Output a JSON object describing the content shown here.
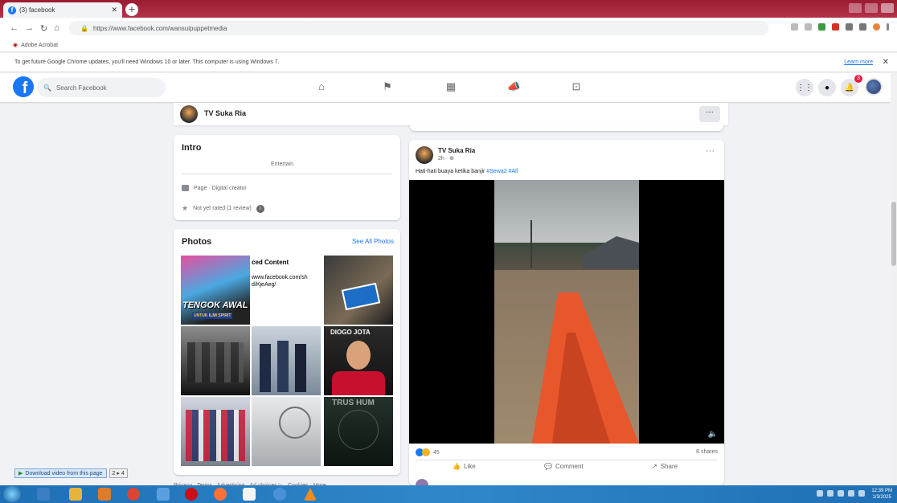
{
  "browser": {
    "tab_title": "(3) facebook",
    "url": "https://www.facebook.com/wansuipuppetmedia",
    "bookmark": "Adobe Acrobat",
    "infobar_text": "To get future Google Chrome updates, you'll need Windows 10 or later. This computer is using Windows 7.",
    "infobar_link": "Learn more"
  },
  "fb": {
    "search_placeholder": "Search Facebook",
    "notification_count": "3"
  },
  "page": {
    "name": "TV Suka Ria",
    "more": "···"
  },
  "intro": {
    "title": "Intro",
    "bio": "Entertain",
    "category": "Page · Digital creator",
    "rating": "Not yet rated (1 review)",
    "rating_info": "i"
  },
  "photos": {
    "title": "Photos",
    "see_all": "See All Photos",
    "tile1_text": "TENGOK AWAL",
    "tile1_sub": "UNTUK ILMI SPIRIT",
    "tile2_title": "ced Content",
    "tile2_link": "www.facebook.com/sh",
    "tile2_link2": "d/KjeAeg/",
    "tile6_text": "DIOGO JOTA",
    "tile9_text": "TRUS HUM"
  },
  "post": {
    "author": "TV Suka Ria",
    "time": "2h · ⊕",
    "text": "Hati-hati buaya ketika banjir",
    "hashtags": "#Sewa2 #All",
    "reaction_count": "45",
    "shares": "8 shares",
    "like": "Like",
    "comment": "Comment",
    "share": "Share",
    "more": "···"
  },
  "footer": {
    "links": "Privacy · Terms · Advertising · Ad choices ▷ · Cookies · More"
  },
  "download_widget": {
    "label": "Download video from this page",
    "count": "2",
    "count2": "4"
  },
  "clock": {
    "time": "12:39 PM",
    "date": "1/3/2025"
  },
  "colors": {
    "fb_blue": "#1877f2",
    "canoe_orange": "#e8562c"
  }
}
